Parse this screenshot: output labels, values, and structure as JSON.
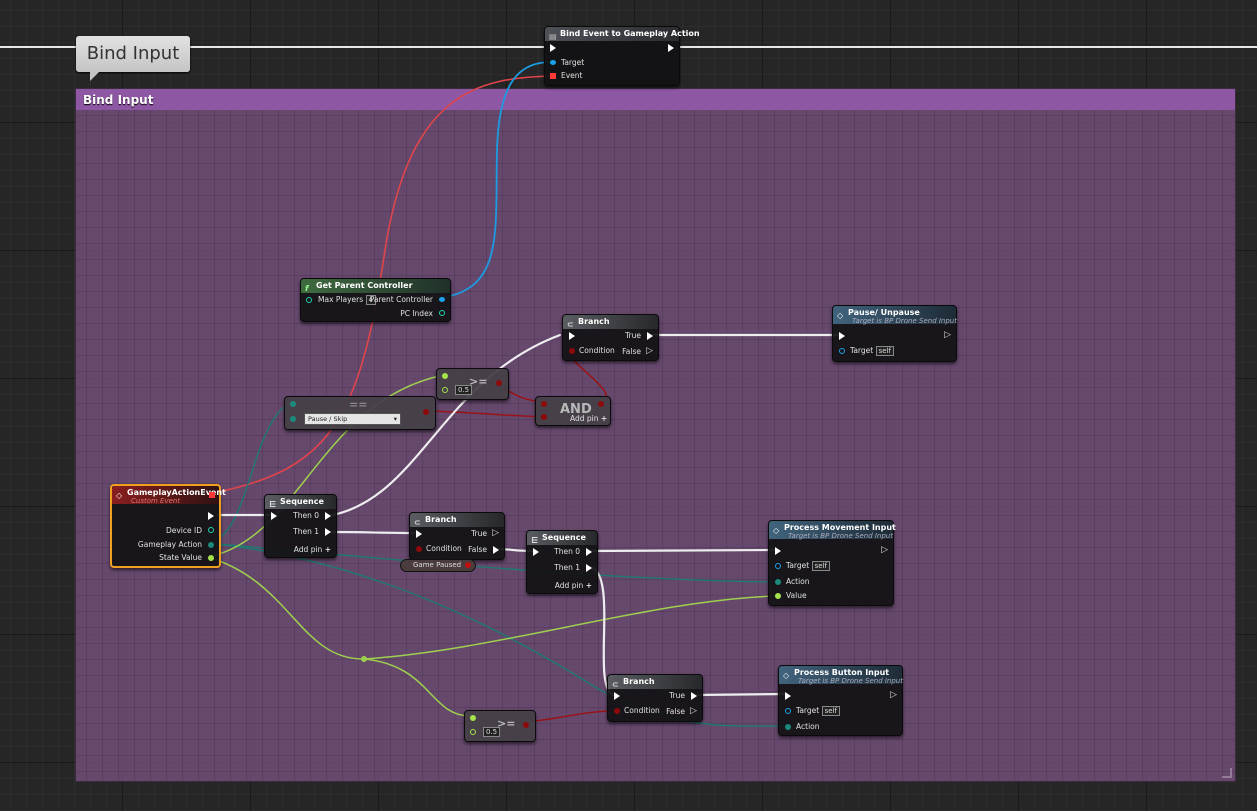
{
  "comment": {
    "bubble_text": "Bind Input",
    "header_text": "Bind Input"
  },
  "colors": {
    "exec": "#ffffff",
    "object": "#1aa3e8",
    "delegate": "#ff3838",
    "struct": "#1b8a7d",
    "float": "#a4e34c",
    "bool": "#8c0a0a",
    "comment_header": "#8e57a3"
  },
  "nodes": {
    "bind_event": {
      "title": "Bind Event to Gameplay Action",
      "icon": "function-icon",
      "pins": {
        "target": "Target",
        "event": "Event"
      }
    },
    "get_parent": {
      "title": "Get Parent Controller",
      "icon": "function-f-icon",
      "pins": {
        "max_players": "Max Players",
        "max_players_value": "4",
        "parent_controller": "Parent Controller",
        "pc_index": "PC Index"
      }
    },
    "branch_top": {
      "title": "Branch",
      "icon": "branch-icon",
      "pins": {
        "true": "True",
        "condition": "Condition",
        "false": "False"
      }
    },
    "pause_unpause": {
      "title": "Pause/ Unpause",
      "subtitle": "Target is BP Drone Send Input",
      "icon": "event-diamond-icon",
      "pins": {
        "target": "Target",
        "target_value": "self"
      }
    },
    "greater_top": {
      "value": "0.5",
      "symbol": ">="
    },
    "equal_action": {
      "combo_value": "Pause / Skip",
      "symbol": "=="
    },
    "and_node": {
      "label": "AND",
      "add_pin": "Add pin"
    },
    "gameplay_event": {
      "title": "GameplayActionEvent",
      "subtitle": "Custom Event",
      "icon": "event-diamond-icon",
      "pins": {
        "device_id": "Device ID",
        "gameplay_action": "Gameplay Action",
        "state_value": "State Value"
      }
    },
    "sequence_left": {
      "title": "Sequence",
      "icon": "sequence-icon",
      "pins": {
        "then0": "Then 0",
        "then1": "Then 1",
        "add_pin": "Add pin"
      }
    },
    "branch_mid": {
      "title": "Branch",
      "icon": "branch-icon",
      "pins": {
        "true": "True",
        "condition": "Condition",
        "false": "False"
      }
    },
    "game_paused": {
      "label": "Game Paused"
    },
    "sequence_mid": {
      "title": "Sequence",
      "icon": "sequence-icon",
      "pins": {
        "then0": "Then 0",
        "then1": "Then 1",
        "add_pin": "Add pin"
      }
    },
    "process_movement": {
      "title": "Process Movement Input",
      "subtitle": "Target is BP Drone Send Input",
      "icon": "event-diamond-icon",
      "pins": {
        "target": "Target",
        "target_value": "self",
        "action": "Action",
        "value": "Value"
      }
    },
    "branch_bottom": {
      "title": "Branch",
      "icon": "branch-icon",
      "pins": {
        "true": "True",
        "condition": "Condition",
        "false": "False"
      }
    },
    "process_button": {
      "title": "Process Button Input",
      "subtitle": "Target is BP Drone Send Input",
      "icon": "event-diamond-icon",
      "pins": {
        "target": "Target",
        "target_value": "self",
        "action": "Action"
      }
    },
    "greater_bottom": {
      "value": "0.5",
      "symbol": ">="
    }
  }
}
